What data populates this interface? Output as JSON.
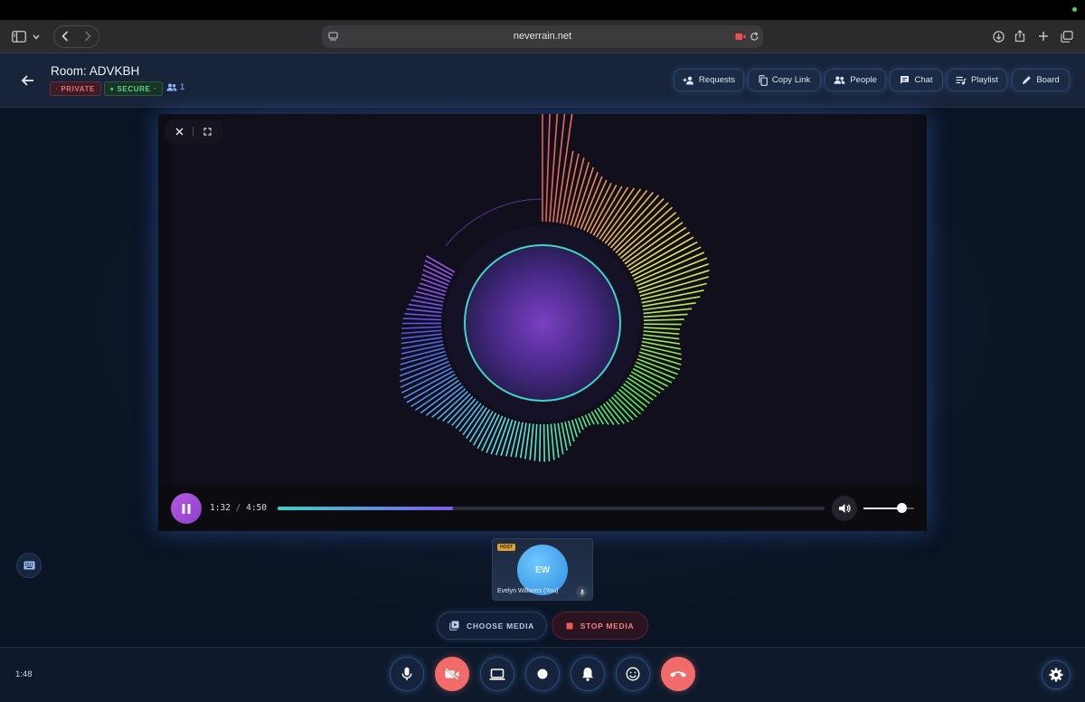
{
  "browser": {
    "url": "neverrain.net"
  },
  "header": {
    "room_title": "Room: ADVKBH",
    "private_badge": "PRIVATE",
    "secure_badge": "SECURE",
    "participant_count": "1",
    "buttons": {
      "requests": "Requests",
      "copy_link": "Copy Link",
      "people": "People",
      "chat": "Chat",
      "playlist": "Playlist",
      "board": "Board"
    }
  },
  "player": {
    "current_time": "1:32",
    "separator": "/",
    "duration": "4:50",
    "progress_fraction": 0.32,
    "volume_fraction": 0.75
  },
  "participant": {
    "host_tag": "HOST",
    "initials": "EW",
    "name": "Evelyn Williams (You)"
  },
  "media": {
    "choose_label": "CHOOSE MEDIA",
    "stop_label": "STOP MEDIA"
  },
  "footer": {
    "clock": "1:48"
  },
  "colors": {
    "accent_purple": "#9a4ddb",
    "danger": "#f16b6b",
    "secure": "#5ed48b"
  },
  "icons": [
    "sidebar-icon",
    "chevron-down-icon",
    "back-icon",
    "forward-icon",
    "site-icon",
    "camera-off-icon",
    "reload-icon",
    "download-icon",
    "share-icon",
    "plus-icon",
    "tabs-icon",
    "arrow-left-icon",
    "lock-icon",
    "shield-icon",
    "people-icon",
    "add-person-icon",
    "copy-icon",
    "chat-icon",
    "playlist-icon",
    "pencil-icon",
    "close-icon",
    "fullscreen-icon",
    "pause-icon",
    "volume-icon",
    "keyboard-icon",
    "mic-icon",
    "video-off-icon",
    "screen-share-icon",
    "record-icon",
    "bell-icon",
    "emoji-icon",
    "hang-up-icon",
    "settings-icon",
    "media-icon",
    "stop-icon"
  ]
}
